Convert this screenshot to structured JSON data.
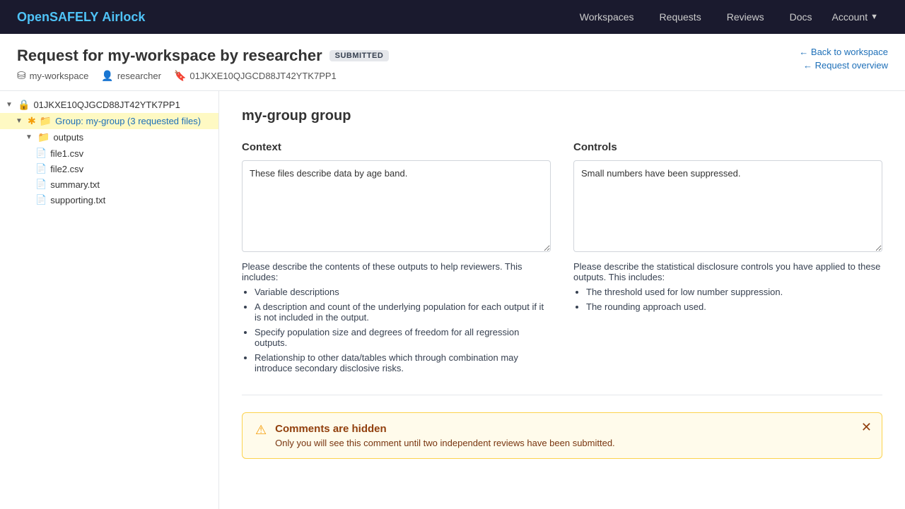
{
  "nav": {
    "logo_open": "OpenSAFELY",
    "logo_airlock": "Airlock",
    "links": [
      "Workspaces",
      "Requests",
      "Reviews",
      "Docs"
    ],
    "account_label": "Account"
  },
  "header": {
    "title": "Request for my-workspace by researcher",
    "badge": "SUBMITTED",
    "meta": {
      "workspace": "my-workspace",
      "user": "researcher",
      "id": "01JKXE10QJGCD88JT42YTK7PP1"
    },
    "back_link": "← Back to workspace",
    "request_overview_link": "← Request overview"
  },
  "sidebar": {
    "root_id": "01JKXE10QJGCD88JT42YTK7PP1",
    "group_label": "Group: my-group (3 requested files)",
    "folder_label": "outputs",
    "files": [
      "file1.csv",
      "file2.csv",
      "summary.txt",
      "supporting.txt"
    ]
  },
  "main": {
    "group_title": "my-group group",
    "context_heading": "Context",
    "context_value": "These files describe data by age band.",
    "controls_heading": "Controls",
    "controls_value": "Small numbers have been suppressed.",
    "context_help": "Please describe the contents of these outputs to help reviewers. This includes:",
    "context_bullets": [
      "Variable descriptions",
      "A description and count of the underlying population for each output if it is not included in the output.",
      "Specify population size and degrees of freedom for all regression outputs.",
      "Relationship to other data/tables which through combination may introduce secondary disclosive risks."
    ],
    "controls_help": "Please describe the statistical disclosure controls you have applied to these outputs. This includes:",
    "controls_bullets": [
      "The threshold used for low number suppression.",
      "The rounding approach used."
    ],
    "comments_banner": {
      "title": "Comments are hidden",
      "text": "Only you will see this comment until two independent reviews have been submitted."
    }
  }
}
